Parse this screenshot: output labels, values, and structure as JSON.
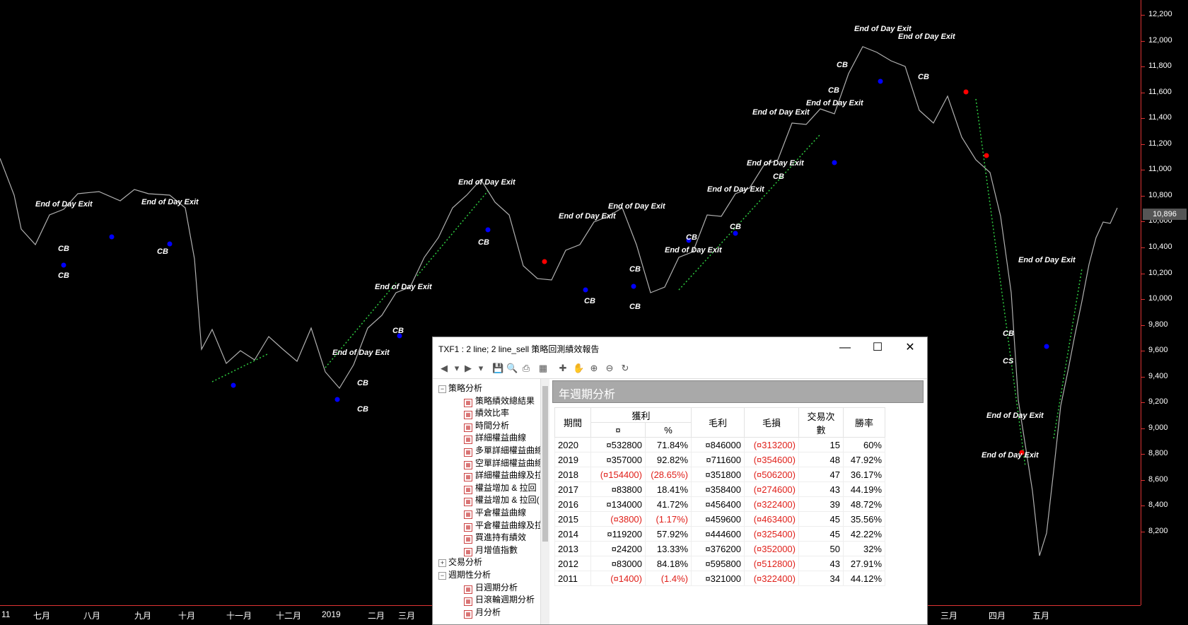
{
  "chart": {
    "price_ticks": [
      "12,200",
      "12,000",
      "11,800",
      "11,600",
      "11,400",
      "11,200",
      "11,000",
      "10,800",
      "10,600",
      "10,400",
      "10,200",
      "10,000",
      "9,800",
      "9,600",
      "9,400",
      "9,200",
      "9,000",
      "8,800",
      "8,600",
      "8,400",
      "8,200"
    ],
    "current_price": "10,896",
    "time_labels": [
      "11",
      "七月",
      "八月",
      "九月",
      "十月",
      "十一月",
      "十二月",
      "2019",
      "二月",
      "三月",
      "二月",
      "三月",
      "四月",
      "五月"
    ],
    "signal_labels": [
      "End of Day Exit",
      "End of Day Exit",
      "End of Day Exit",
      "End of Day Exit",
      "End of Day Exit",
      "End of Day Exit",
      "End of Day Exit",
      "End of Day Exit",
      "End of Day Exit",
      "End of Day Exit",
      "End of Day Exit",
      "End of Day Exit",
      "End of Day Exit",
      "End of Day Exit",
      "End of Day Exit",
      "End of Day Exit",
      "End of Day Exit",
      "CB",
      "CB",
      "CB",
      "CB",
      "CB",
      "CB",
      "CB",
      "CB",
      "CB",
      "CB",
      "CB",
      "CB",
      "CB",
      "CB",
      "CB",
      "CB",
      "CB",
      "CS"
    ],
    "colors": {
      "background": "#000000",
      "axis": "#dd3333",
      "price_line": "#b0b0b0",
      "trend_line": "#2ecc40",
      "buy_marker": "#0000ff",
      "sell_marker": "#ff0000"
    }
  },
  "window": {
    "title": "TXF1 : 2 line; 2 line_sell 策略回測績效報告",
    "minimize_icon": "minimize-icon",
    "maximize_icon": "maximize-icon",
    "close_icon": "close-icon"
  },
  "tree": {
    "groups": [
      {
        "label": "策略分析",
        "toggle": "−",
        "items": [
          "策略績效總結果",
          "績效比率",
          "時間分析",
          "詳細權益曲線",
          "多單詳細權益曲線",
          "空單詳細權益曲線",
          "詳細權益曲線及拉",
          "權益增加 & 拉回",
          "權益增加 & 拉回(",
          "平倉權益曲線",
          "平倉權益曲線及拉",
          "買進持有績效",
          "月增值指數"
        ]
      },
      {
        "label": "交易分析",
        "toggle": "+",
        "items": []
      },
      {
        "label": "週期性分析",
        "toggle": "−",
        "items": [
          "日週期分析",
          "日滾輪週期分析",
          "月分析"
        ]
      }
    ]
  },
  "report": {
    "section_title": "年週期分析",
    "headers": {
      "period": "期間",
      "profit": "獲利",
      "currency": "¤",
      "percent": "%",
      "gross_profit": "毛利",
      "gross_loss": "毛損",
      "trades": "交易次數",
      "win_rate": "勝率"
    },
    "rows": [
      {
        "period": "2020",
        "profit": "¤532800",
        "pct": "71.84%",
        "gross_profit": "¤846000",
        "gross_loss": "(¤313200)",
        "trades": "15",
        "win_rate": "60%",
        "neg": false
      },
      {
        "period": "2019",
        "profit": "¤357000",
        "pct": "92.82%",
        "gross_profit": "¤711600",
        "gross_loss": "(¤354600)",
        "trades": "48",
        "win_rate": "47.92%",
        "neg": false
      },
      {
        "period": "2018",
        "profit": "(¤154400)",
        "pct": "(28.65%)",
        "gross_profit": "¤351800",
        "gross_loss": "(¤506200)",
        "trades": "47",
        "win_rate": "36.17%",
        "neg": true
      },
      {
        "period": "2017",
        "profit": "¤83800",
        "pct": "18.41%",
        "gross_profit": "¤358400",
        "gross_loss": "(¤274600)",
        "trades": "43",
        "win_rate": "44.19%",
        "neg": false
      },
      {
        "period": "2016",
        "profit": "¤134000",
        "pct": "41.72%",
        "gross_profit": "¤456400",
        "gross_loss": "(¤322400)",
        "trades": "39",
        "win_rate": "48.72%",
        "neg": false
      },
      {
        "period": "2015",
        "profit": "(¤3800)",
        "pct": "(1.17%)",
        "gross_profit": "¤459600",
        "gross_loss": "(¤463400)",
        "trades": "45",
        "win_rate": "35.56%",
        "neg": true
      },
      {
        "period": "2014",
        "profit": "¤119200",
        "pct": "57.92%",
        "gross_profit": "¤444600",
        "gross_loss": "(¤325400)",
        "trades": "45",
        "win_rate": "42.22%",
        "neg": false
      },
      {
        "period": "2013",
        "profit": "¤24200",
        "pct": "13.33%",
        "gross_profit": "¤376200",
        "gross_loss": "(¤352000)",
        "trades": "50",
        "win_rate": "32%",
        "neg": false
      },
      {
        "period": "2012",
        "profit": "¤83000",
        "pct": "84.18%",
        "gross_profit": "¤595800",
        "gross_loss": "(¤512800)",
        "trades": "43",
        "win_rate": "27.91%",
        "neg": false
      },
      {
        "period": "2011",
        "profit": "(¤1400)",
        "pct": "(1.4%)",
        "gross_profit": "¤321000",
        "gross_loss": "(¤322400)",
        "trades": "34",
        "win_rate": "44.12%",
        "neg": true
      }
    ]
  }
}
